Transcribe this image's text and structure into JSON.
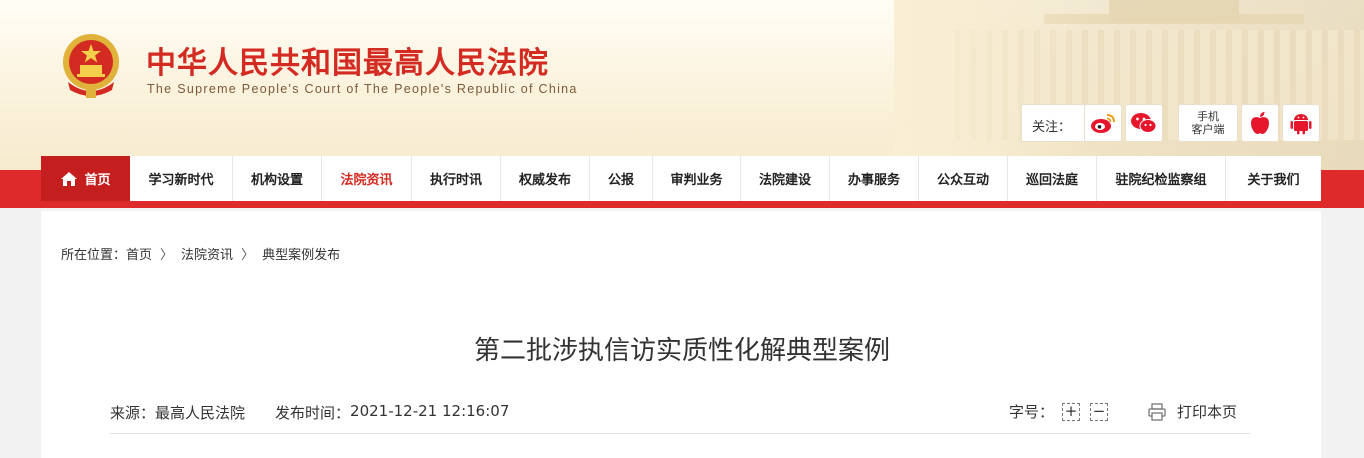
{
  "header": {
    "title": "中华人民共和国最高人民法院",
    "subtitle": "The Supreme People's Court of The People's Republic of China",
    "follow_label": "关注：",
    "mobile_line1": "手机",
    "mobile_line2": "客户端",
    "icons": [
      "national-emblem",
      "weibo-icon",
      "wechat-icon",
      "apple-icon",
      "android-icon"
    ]
  },
  "nav": {
    "items": [
      {
        "label": "首页",
        "icon": "home-icon"
      },
      {
        "label": "学习新时代"
      },
      {
        "label": "机构设置"
      },
      {
        "label": "法院资讯"
      },
      {
        "label": "执行时讯"
      },
      {
        "label": "权威发布"
      },
      {
        "label": "公报"
      },
      {
        "label": "审判业务"
      },
      {
        "label": "法院建设"
      },
      {
        "label": "办事服务"
      },
      {
        "label": "公众互动"
      },
      {
        "label": "巡回法庭"
      },
      {
        "label": "驻院纪检监察组"
      },
      {
        "label": "关于我们"
      }
    ],
    "active": "法院资讯"
  },
  "breadcrumb": {
    "prefix": "所在位置：",
    "items": [
      "首页",
      "法院资讯",
      "典型案例发布"
    ],
    "separator": "〉"
  },
  "article": {
    "title": "第二批涉执信访实质性化解典型案例",
    "source_label": "来源：",
    "source": "最高人民法院",
    "time_label": "发布时间：",
    "time": "2021-12-21 12:16:07",
    "font_size_label": "字号：",
    "increase": "+",
    "decrease": "−",
    "print_label": "打印本页"
  },
  "colors": {
    "brand_red": "#d32a22",
    "nav_red": "#df2a2b",
    "home_red": "#c41e1e",
    "header_cream": "#fbf2dc"
  }
}
